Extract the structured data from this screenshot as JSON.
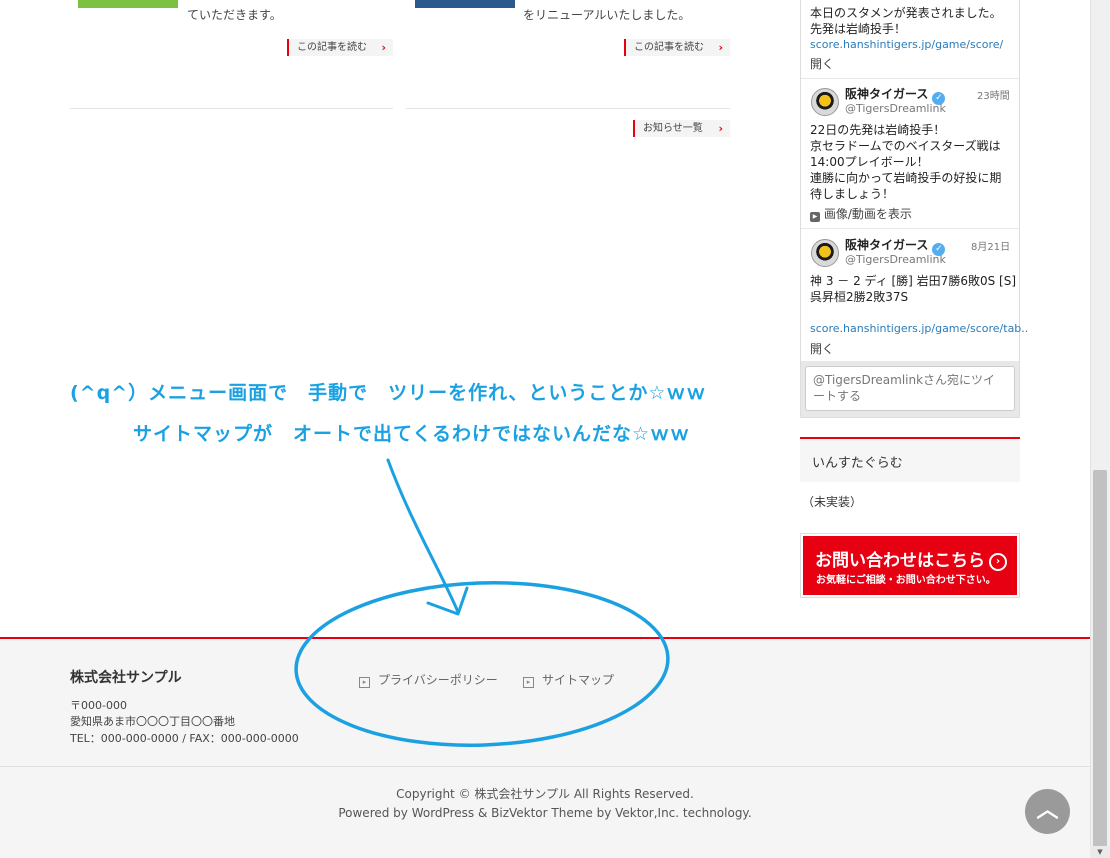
{
  "articles": [
    {
      "excerpt": "ていただきます。",
      "read_more": "この記事を読む"
    },
    {
      "excerpt": "をリニューアルいたしました。",
      "read_more": "この記事を読む"
    }
  ],
  "news_list_button": "お知らせ一覧",
  "twitter": {
    "tweet0": {
      "text": "本日のスタメンが発表されました。",
      "text2": "先発は岩崎投手！",
      "link": "score.hanshintigers.jp/game/score/",
      "expand": "開く"
    },
    "tweet1": {
      "name": "阪神タイガース",
      "handle": "@TigersDreamlink",
      "time": "23時間",
      "lines": [
        "22日の先発は岩崎投手！",
        "京セラドームでのベイスターズ戦は",
        "14:00プレイボール！",
        "連勝に向かって岩崎投手の好投に期",
        "待しましょう！"
      ],
      "media": "画像/動画を表示"
    },
    "tweet2": {
      "name": "阪神タイガース",
      "handle": "@TigersDreamlink",
      "time": "8月21日",
      "lines": [
        "神 3 － 2 ディ [勝] 岩田7勝6敗0S [S]",
        "呉昇桓2勝2敗37S"
      ],
      "link": "score.hanshintigers.jp/game/score/tab..",
      "expand": "開く"
    },
    "compose_line1": "@TigersDreamlinkさん宛にツイ",
    "compose_line2": "ートする"
  },
  "sidebar": {
    "section_title": "いんすたぐらむ",
    "note": "（未実装）",
    "contact_main": "お問い合わせはこちら",
    "contact_sub": "お気軽にご相談・お問い合わせ下さい。"
  },
  "annotation": {
    "line1": "(^q^）メニュー画面で　手動で　ツリーを作れ、ということか☆ｗｗ",
    "line2": "サイトマップが　オートで出てくるわけではないんだな☆ｗｗ"
  },
  "footer": {
    "company": "株式会社サンプル",
    "postal": "〒000-000",
    "address": "愛知県あま市〇〇〇丁目〇〇番地",
    "tel_fax": "TEL：000-000-0000 / FAX：000-000-0000",
    "nav": [
      "プライバシーポリシー",
      "サイトマップ"
    ],
    "copyright": "Copyright © 株式会社サンプル All Rights Reserved.",
    "powered": "Powered by WordPress & BizVektor Theme by Vektor,Inc. technology."
  },
  "colors": {
    "accent": "#e60012",
    "annotation": "#1ba1e2",
    "twitter_link": "#2b7bb9"
  }
}
